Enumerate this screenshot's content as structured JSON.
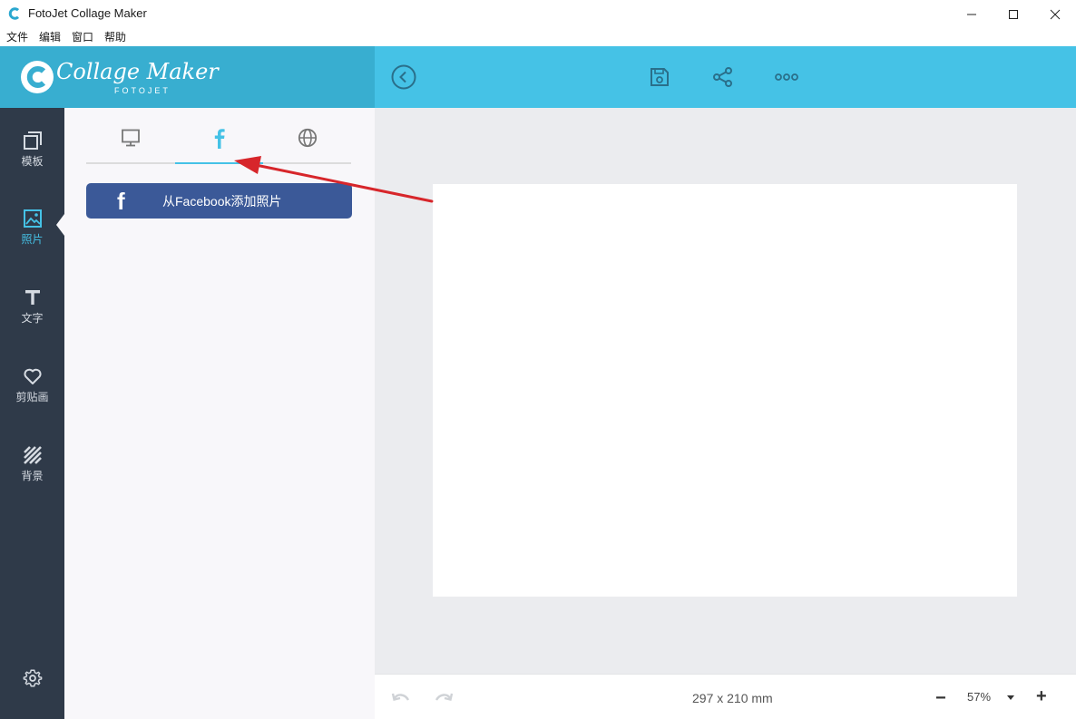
{
  "window": {
    "title": "FotoJet Collage Maker",
    "controls": [
      "minimize-icon",
      "maximize-icon",
      "close-icon"
    ]
  },
  "menu": {
    "items": [
      "文件",
      "编辑",
      "窗口",
      "帮助"
    ]
  },
  "header": {
    "logo_text": "Collage Maker",
    "logo_sub": "FOTOJET",
    "toolbar_icons": [
      "back-icon",
      "save-icon",
      "share-icon",
      "more-icon"
    ]
  },
  "sidebar": {
    "items": [
      {
        "label": "模板",
        "icon": "template-icon"
      },
      {
        "label": "照片",
        "icon": "photo-icon",
        "active": true
      },
      {
        "label": "文字",
        "icon": "text-icon"
      },
      {
        "label": "剪贴画",
        "icon": "heart-icon"
      },
      {
        "label": "背景",
        "icon": "background-icon"
      }
    ],
    "settings_icon": "gear-icon"
  },
  "panel": {
    "tabs": [
      {
        "icon": "computer-icon"
      },
      {
        "icon": "facebook-icon",
        "active": true
      },
      {
        "icon": "globe-icon"
      }
    ],
    "facebook_button": {
      "icon_glyph": "f",
      "label": "从Facebook添加照片"
    }
  },
  "bottom": {
    "canvas_size": "297 x 210 mm",
    "zoom": "57%",
    "zoom_minus": "−",
    "zoom_plus": "+"
  },
  "colors": {
    "header_dark": "#38aed0",
    "header_light": "#45c2e6",
    "sidebar": "#2f3a49",
    "panel": "#f8f7fa",
    "canvas_bg": "#ebecef",
    "facebook": "#3b5998",
    "annotation_arrow": "#d7262b"
  }
}
